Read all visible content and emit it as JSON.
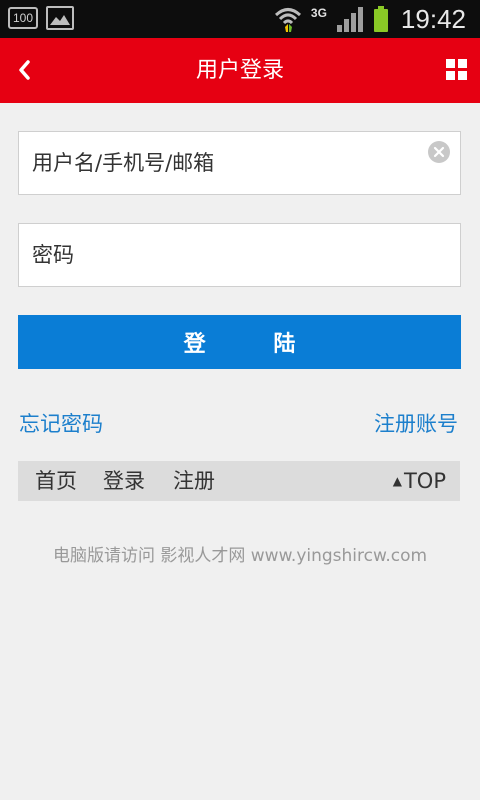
{
  "status_bar": {
    "battery_text": "100",
    "network": "3G",
    "time": "19:42"
  },
  "header": {
    "title": "用户登录"
  },
  "form": {
    "username_placeholder": "用户名/手机号/邮箱",
    "password_placeholder": "密码",
    "login_label": "登 陆"
  },
  "links": {
    "forgot_password": "忘记密码",
    "register_account": "注册账号"
  },
  "footer_nav": {
    "items": [
      "首页",
      "登录",
      "注册"
    ],
    "top_label": "TOP"
  },
  "site_note": "电脑版请访问 影视人才网 www.yingshircw.com",
  "colors": {
    "header_bg": "#e60012",
    "button_bg": "#0a7dd6",
    "link": "#1c7fcc"
  }
}
